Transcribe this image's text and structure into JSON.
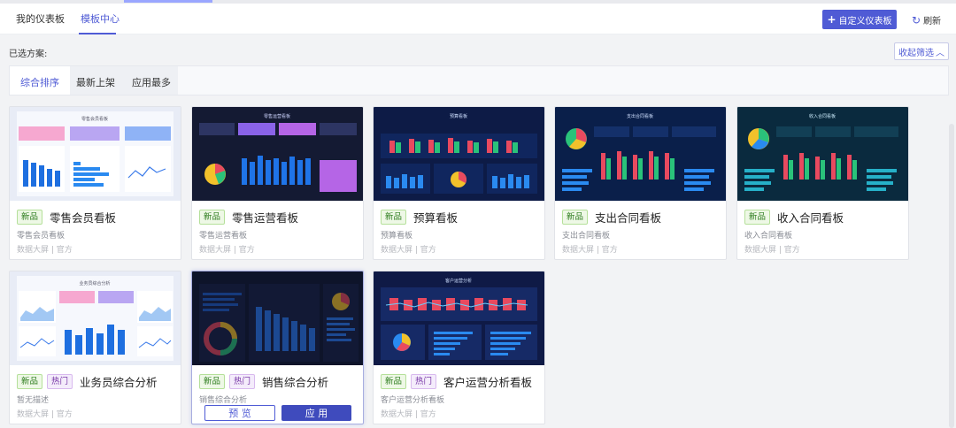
{
  "header": {
    "tabs": [
      {
        "label": "我的仪表板"
      },
      {
        "label": "模板中心"
      }
    ],
    "custom_button": "自定义仪表板",
    "refresh_button": "刷新"
  },
  "filter": {
    "selected_label": "已选方案:",
    "collapse_button": "收起筛选"
  },
  "sort": {
    "options": [
      "综合排序",
      "最新上架",
      "应用最多"
    ]
  },
  "cards": [
    {
      "tags": [
        "新品"
      ],
      "title": "零售会员看板",
      "desc": "零售会员看板",
      "meta": "数据大屏 | 官方"
    },
    {
      "tags": [
        "新品"
      ],
      "title": "零售运营看板",
      "desc": "零售运营看板",
      "meta": "数据大屏 | 官方"
    },
    {
      "tags": [
        "新品"
      ],
      "title": "预算看板",
      "desc": "预算看板",
      "meta": "数据大屏 | 官方"
    },
    {
      "tags": [
        "新品"
      ],
      "title": "支出合同看板",
      "desc": "支出合同看板",
      "meta": "数据大屏 | 官方"
    },
    {
      "tags": [
        "新品"
      ],
      "title": "收入合同看板",
      "desc": "收入合同看板",
      "meta": "数据大屏 | 官方"
    },
    {
      "tags": [
        "新品",
        "热门"
      ],
      "title": "业务员综合分析",
      "desc": "暂无描述",
      "meta": "数据大屏 | 官方"
    },
    {
      "tags": [
        "新品",
        "热门"
      ],
      "title": "销售综合分析",
      "desc": "销售综合分析",
      "preview_button": "预 览",
      "apply_button": "应 用"
    },
    {
      "tags": [
        "新品",
        "热门"
      ],
      "title": "客户运营分析看板",
      "desc": "客户运营分析看板",
      "meta": "数据大屏 | 官方"
    }
  ],
  "thumb_titles": [
    "零售会员看板",
    "零售运营看板",
    "预算看板",
    "支出合同看板",
    "收入合同看板",
    "业务员综合分析",
    "",
    "客户运营分析"
  ],
  "colors": {
    "accent": "#4f5bd5",
    "new_tag": "#2e7d1f",
    "hot_tag": "#7a3aa8"
  }
}
